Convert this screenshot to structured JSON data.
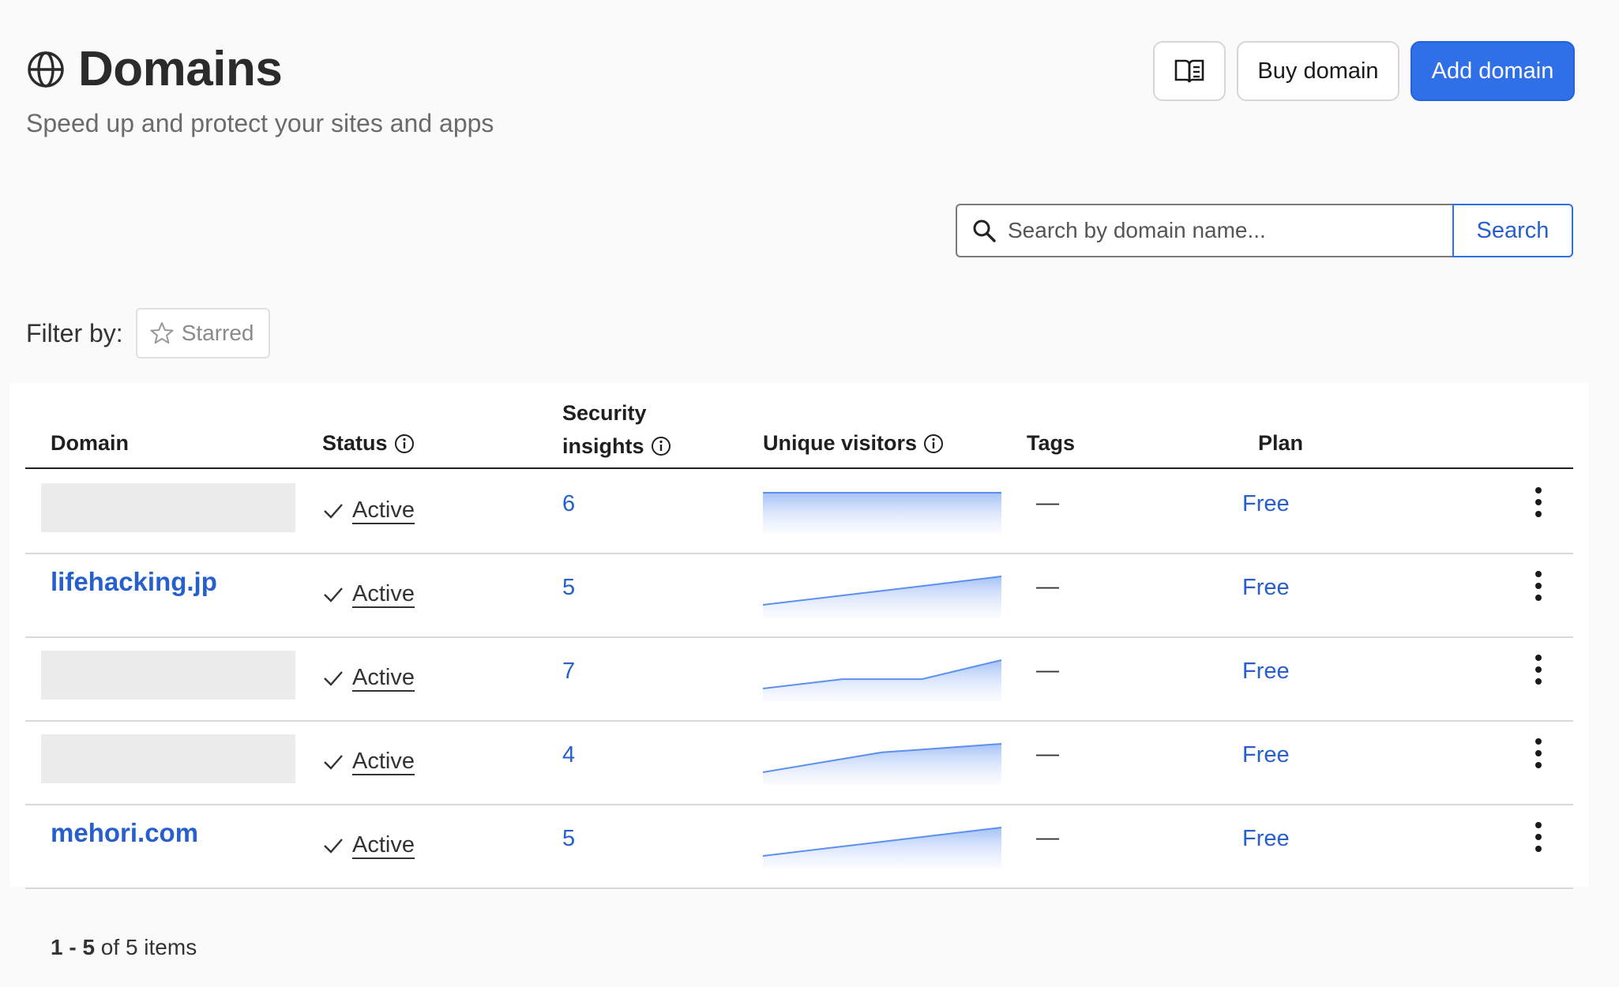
{
  "header": {
    "title": "Domains",
    "subtitle": "Speed up and protect your sites and apps",
    "title_icon": "globe-icon",
    "docs_icon": "book-icon",
    "buy_label": "Buy domain",
    "add_label": "Add domain"
  },
  "search": {
    "placeholder": "Search by domain name...",
    "button_label": "Search",
    "icon": "search-icon"
  },
  "filter": {
    "label": "Filter by:",
    "chip_label": "Starred",
    "chip_icon": "star-icon"
  },
  "table": {
    "columns": {
      "domain": "Domain",
      "status": "Status",
      "security_line1": "Security",
      "security_line2": "insights",
      "visitors": "Unique visitors",
      "tags": "Tags",
      "plan": "Plan"
    },
    "rows": [
      {
        "domain": "",
        "status": "Active",
        "insights": "6",
        "visitors_trend": [
          1,
          1,
          1,
          1
        ],
        "tags": "—",
        "plan": "Free"
      },
      {
        "domain": "lifehacking.jp",
        "status": "Active",
        "insights": "5",
        "visitors_trend": [
          0,
          0.33,
          0.66,
          1
        ],
        "tags": "—",
        "plan": "Free"
      },
      {
        "domain": "",
        "status": "Active",
        "insights": "7",
        "visitors_trend": [
          0,
          0.33,
          0.33,
          1
        ],
        "tags": "—",
        "plan": "Free"
      },
      {
        "domain": "",
        "status": "Active",
        "insights": "4",
        "visitors_trend": [
          0,
          0.7,
          1
        ],
        "tags": "—",
        "plan": "Free"
      },
      {
        "domain": "mehori.com",
        "status": "Active",
        "insights": "5",
        "visitors_trend": [
          0,
          0.5,
          1
        ],
        "tags": "—",
        "plan": "Free"
      }
    ]
  },
  "pagination": {
    "range": "1 - 5",
    "suffix": " of 5 items"
  },
  "colors": {
    "accent": "#2f6fe8",
    "link": "#2760cc",
    "spark_line": "#5b8ff0",
    "spark_fill": "#dbe6fc"
  }
}
